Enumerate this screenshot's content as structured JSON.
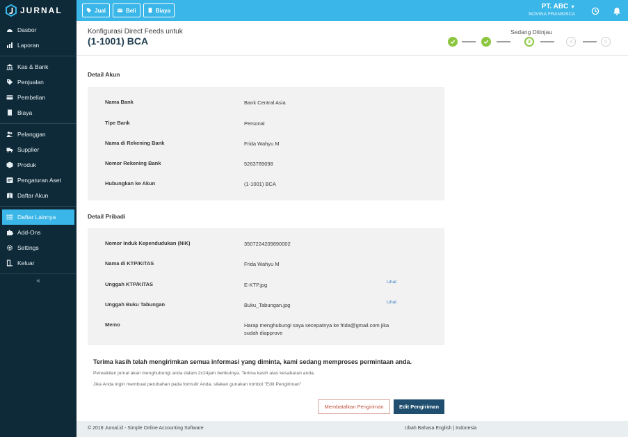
{
  "app": {
    "logo_text": "JURNAL"
  },
  "sidebar": {
    "group1": [
      {
        "label": "Dasbor",
        "icon": "dashboard-icon"
      },
      {
        "label": "Laporan",
        "icon": "chart-icon"
      }
    ],
    "group2": [
      {
        "label": "Kas & Bank",
        "icon": "bank-icon"
      },
      {
        "label": "Penjualan",
        "icon": "tag-icon"
      },
      {
        "label": "Pembelian",
        "icon": "card-icon"
      },
      {
        "label": "Biaya",
        "icon": "receipt-icon"
      }
    ],
    "group3": [
      {
        "label": "Pelanggan",
        "icon": "users-icon"
      },
      {
        "label": "Supplier",
        "icon": "truck-icon"
      },
      {
        "label": "Produk",
        "icon": "box-icon"
      },
      {
        "label": "Pengaturan Aset",
        "icon": "asset-icon"
      },
      {
        "label": "Daftar Akun",
        "icon": "book-icon"
      }
    ],
    "group4": [
      {
        "label": "Daftar Lainnya",
        "icon": "list-icon",
        "active": true
      },
      {
        "label": "Add-Ons",
        "icon": "puzzle-icon"
      },
      {
        "label": "Settings",
        "icon": "gear-icon"
      },
      {
        "label": "Keluar",
        "icon": "logout-icon"
      }
    ],
    "collapse_glyph": "«"
  },
  "topbar": {
    "jual_label": "Jual",
    "beli_label": "Beli",
    "biaya_label": "Biaya",
    "company_name": "PT. ABC",
    "user_name": "NOVINA FRANSISCA"
  },
  "header": {
    "title_sub": "Konfigurasi Direct Feeds untuk",
    "title_main": "(1-1001) BCA",
    "status_label": "Sedang Ditinjau",
    "steps": [
      "1",
      "2",
      "3",
      "4",
      "5"
    ],
    "current_step": 3
  },
  "account_section": {
    "title": "Detail Akun",
    "rows": [
      {
        "label": "Nama Bank",
        "value": "Bank Central Asia"
      },
      {
        "label": "Tipe Bank",
        "value": "Personal"
      },
      {
        "label": "Nama di Rekening Bank",
        "value": "Frida Wahyu M"
      },
      {
        "label": "Nomor Rekening Bank",
        "value": "5263789098"
      },
      {
        "label": "Hubungkan ke Akun",
        "value": "(1-1001) BCA"
      }
    ]
  },
  "personal_section": {
    "title": "Detail Pribadi",
    "rows": [
      {
        "label": "Nomor Induk Kependudukan (NIK)",
        "value": "3507224209890002"
      },
      {
        "label": "Nama di KTP/KITAS",
        "value": "Frida Wahyu M"
      },
      {
        "label": "Unggah KTP/KITAS",
        "value": "E-KTP.jpg",
        "link": "Lihat"
      },
      {
        "label": "Unggah Buku Tabungan",
        "value": "Buku_Tabungan.jpg",
        "link": "Lihat"
      },
      {
        "label": "Memo",
        "value": "Harap menghubungi saya secepatnya ke frida@gmail.com jika sudah diapprove"
      }
    ]
  },
  "message": {
    "thanks": "Terima kasih telah mengirimkan semua informasi yang diminta, kami sedang memproses permintaan anda.",
    "note1": "Perwakilan jurnal akan menghubungi anda dalam 2x24jam berikutnya. Terima kasih atas kesabaran anda.",
    "note2": "Jika Anda ingin membuat perubahan pada formulir Anda, silakan gunakan tombol \"Edit Pengiriman\""
  },
  "actions": {
    "cancel_label": "Membatalkan Pengiriman",
    "edit_label": "Edit Pengiriman"
  },
  "footer": {
    "copyright": "© 2018 Jurnal.id - Simple Online Accounting Software",
    "lang_prefix": "Ubah Bahasa",
    "lang_en": "English",
    "lang_sep": "|",
    "lang_id": "Indonesia"
  },
  "colors": {
    "sidebar_bg": "#0e2a38",
    "topbar_bg": "#3ab6e8",
    "active_item": "#3ab6e8",
    "step_done": "#8cc63f",
    "primary_button": "#1f4e6e",
    "cancel_border": "#d9a49a"
  }
}
